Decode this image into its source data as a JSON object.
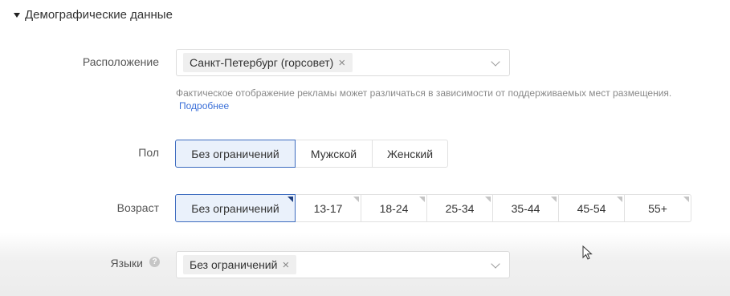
{
  "section": {
    "title": "Демографические данные"
  },
  "location": {
    "label": "Расположение",
    "selected_tag": "Санкт-Петербург (горсовет)",
    "hint": "Фактическое отображение рекламы может различаться в зависимости от поддерживаемых мест размещения.",
    "link": "Подробнее"
  },
  "gender": {
    "label": "Пол",
    "options": [
      "Без ограничений",
      "Мужской",
      "Женский"
    ],
    "selected": "Без ограничений"
  },
  "age": {
    "label": "Возраст",
    "options": [
      "Без ограничений",
      "13-17",
      "18-24",
      "25-34",
      "35-44",
      "45-54",
      "55+"
    ],
    "selected": "Без ограничений"
  },
  "languages": {
    "label": "Языки",
    "help_icon": "question-icon",
    "selected_tag": "Без ограничений"
  },
  "colors": {
    "accent": "#3c6bbf",
    "link": "#3a6fd8",
    "active_bg": "#eaf1fb"
  }
}
